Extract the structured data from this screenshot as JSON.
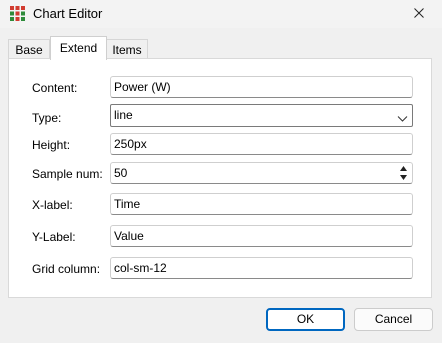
{
  "window": {
    "title": "Chart Editor"
  },
  "tabs": [
    {
      "label": "Base"
    },
    {
      "label": "Extend"
    },
    {
      "label": "Items"
    }
  ],
  "form": {
    "content": {
      "label": "Content:",
      "value": "Power (W)"
    },
    "type": {
      "label": "Type:",
      "value": "line"
    },
    "height": {
      "label": "Height:",
      "value": "250px"
    },
    "sample_num": {
      "label": "Sample num:",
      "value": "50"
    },
    "x_label": {
      "label": "X-label:",
      "value": "Time"
    },
    "y_label": {
      "label": "Y-Label:",
      "value": "Value"
    },
    "grid_column": {
      "label": "Grid column:",
      "value": "col-sm-12"
    }
  },
  "buttons": {
    "ok": "OK",
    "cancel": "Cancel"
  },
  "colors": {
    "accent": "#0067c0",
    "icon_red": "#d13b2f",
    "icon_green": "#2e8b3a"
  }
}
